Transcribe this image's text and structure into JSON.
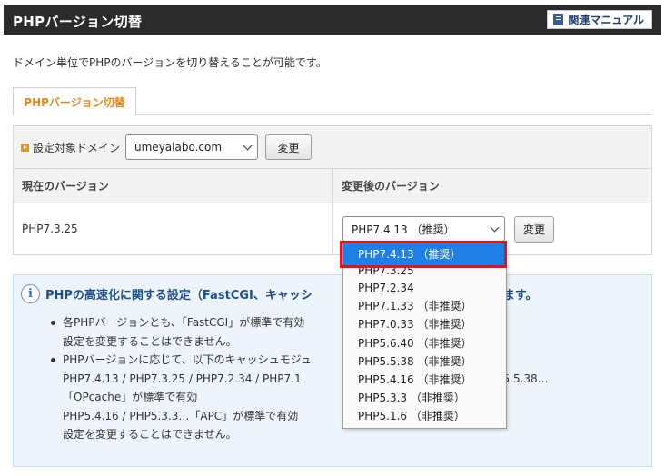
{
  "header": {
    "title": "PHPバージョン切替",
    "manual_label": "関連マニュアル"
  },
  "intro_text": "ドメイン単位でPHPのバージョンを切り替えることが可能です。",
  "tab": {
    "label": "PHPバージョン切替"
  },
  "domain_row": {
    "label": "設定対象ドメイン",
    "selected_domain": "umeyalabo.com",
    "change_label": "変更"
  },
  "table": {
    "col_current": "現在のバージョン",
    "col_new": "変更後のバージョン",
    "current_version": "PHP7.3.25",
    "new_version_selected": "PHP7.4.13 （推奨）",
    "change_label": "変更"
  },
  "dropdown": {
    "options": [
      "PHP7.4.13 （推奨）",
      "PHP7.3.25",
      "PHP7.2.34",
      "PHP7.1.33 （非推奨）",
      "PHP7.0.33 （非推奨）",
      "PHP5.6.40 （非推奨）",
      "PHP5.5.38 （非推奨）",
      "PHP5.4.16 （非推奨）",
      "PHP5.3.3 （非推奨）",
      "PHP5.1.6 （非推奨）"
    ],
    "selected_index": 0
  },
  "info": {
    "title_left": "PHPの高速化に関する設定（FastCGI、キャッシ",
    "title_right": "効になります。",
    "bullet1_line1": "各PHPバージョンとも、「FastCGI」が標準で有効",
    "bullet1_line2": "設定を変更することはできません。",
    "bullet2_line1": "PHPバージョンに応じて、以下のキャッシュモジュ",
    "bullet2_line2_left": "PHP7.4.13 / PHP7.3.25 / PHP7.2.34 / PHP7.1",
    "bullet2_line2_right": ".40 / PHP5.5.38…",
    "bullet2_line3": "「OPcache」が標準で有効",
    "bullet2_line4": "PHP5.4.16 / PHP5.3.3…「APC」が標準で有効",
    "bullet2_line5": "設定を変更することはできません。"
  },
  "colors": {
    "header_bg": "#2b2b2b",
    "tab_text": "#e08a1e",
    "selected_option": "#1e7fe6",
    "highlight_border": "#e8101a",
    "info_bg": "#eef4fb"
  }
}
